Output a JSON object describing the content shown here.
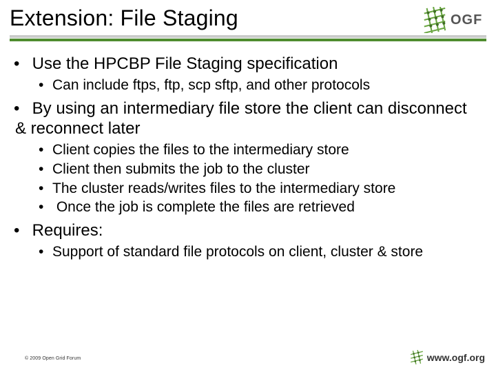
{
  "slide": {
    "title": "Extension: File Staging",
    "bullets": [
      {
        "text": "Use the HPCBP File Staging specification",
        "sub": [
          "Can include ftps, ftp, scp sftp, and other protocols"
        ]
      },
      {
        "text": "By using an intermediary file store the client can disconnect & reconnect later",
        "sub": [
          "Client copies the files to the intermediary store",
          "Client then submits the job to the cluster",
          "The cluster reads/writes files to the intermediary store",
          " Once the job is complete the files are retrieved"
        ]
      },
      {
        "text": "Requires:",
        "sub": [
          "Support of standard file protocols on client, cluster & store"
        ]
      }
    ]
  },
  "footer": {
    "copyright": "© 2009 Open Grid Forum",
    "url": "www.ogf.org"
  },
  "logo": {
    "text": "OGF"
  }
}
